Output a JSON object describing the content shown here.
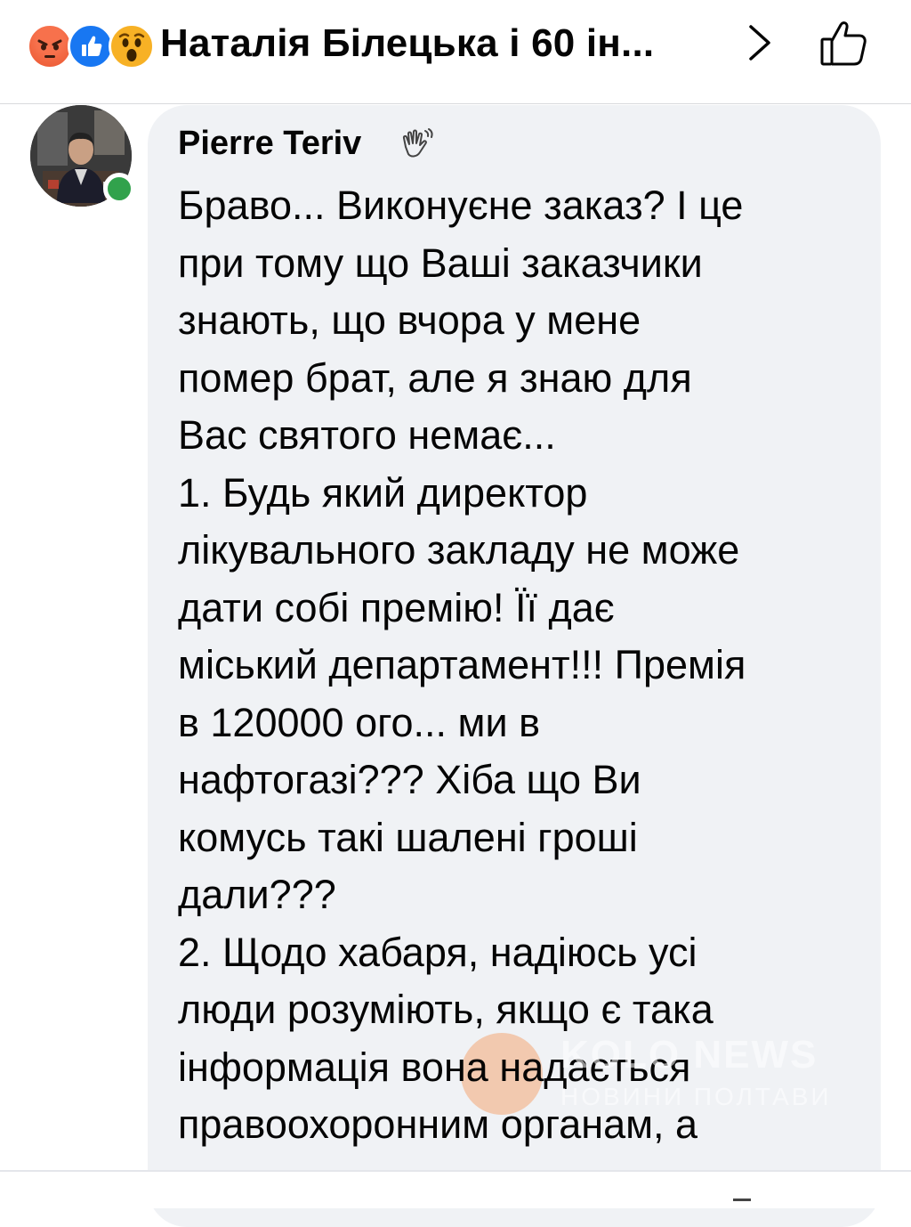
{
  "header": {
    "reactions": [
      "angry-reaction",
      "like-reaction",
      "wow-reaction"
    ],
    "title": "Наталія Білецька і 60 ін...",
    "chevron_icon": "chevron-right-icon",
    "like_icon": "thumbs-up-outline-icon"
  },
  "comment": {
    "author": "Pierre Teriv",
    "author_badge_icon": "waving-hand-icon",
    "online": true,
    "lines": [
      "Браво... Виконуєне заказ? І це",
      "при тому що Ваші заказчики",
      "знають, що вчора у мене",
      "помер брат, але я знаю для",
      "Вас святого немає...",
      "1. Будь який директор",
      "лікувального закладу не може",
      "дати собі премію! Її дає",
      "міський департамент!!! Премія",
      "в 120000 ого... ми в",
      "нафтогазі??? Хіба що Ви",
      "комусь такі шалені гроші",
      "дали???",
      "2. Щодо хабаря, надіюсь усі",
      "люди розуміють, якщо є така",
      "інформація вона надається",
      "правоохоронним органам, а"
    ]
  },
  "watermark": {
    "title": "KOLO NEWS",
    "subtitle": "НОВИНИ ПОЛТАВИ"
  },
  "colors": {
    "bubble": "#f0f2f5",
    "online": "#31a24c",
    "like_blue": "#1877f2"
  }
}
